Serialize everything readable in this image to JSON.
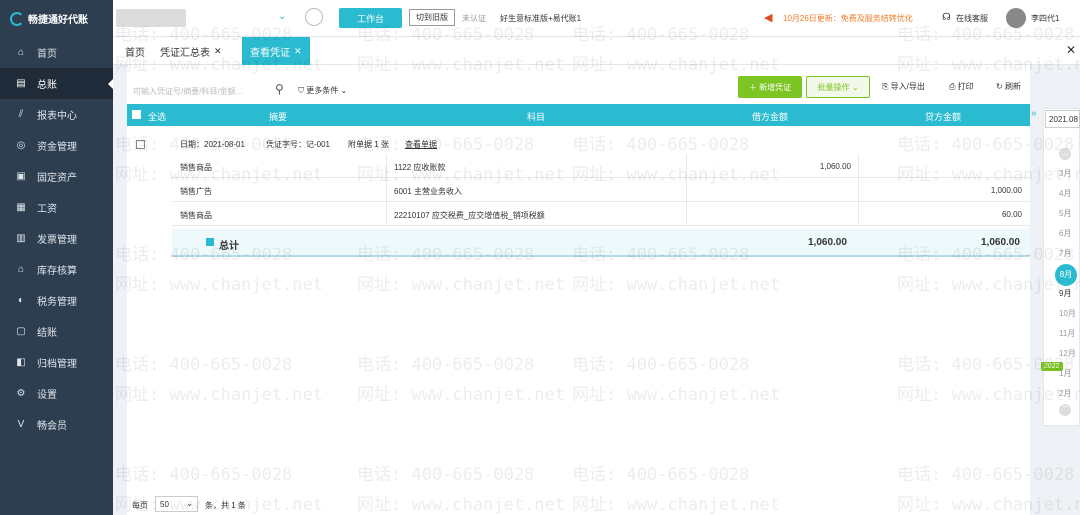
{
  "topbar": {
    "brand": "畅捷通好代账",
    "workbench_label": "工作台",
    "switch_old_label": "切到旧版",
    "verify_text": "未认证",
    "edition_text": "好生意标准版+易代账1",
    "news_text": "10月26日更新：免费及服务结转优化",
    "service_label": "在线客服",
    "username": "李四代1"
  },
  "sidebar": {
    "items": [
      {
        "label": "首页",
        "icon": "home-icon",
        "glyph": "⌂"
      },
      {
        "label": "总账",
        "icon": "ledger-icon",
        "glyph": "▤"
      },
      {
        "label": "报表中心",
        "icon": "chart-icon",
        "glyph": "⫽"
      },
      {
        "label": "资金管理",
        "icon": "money-icon",
        "glyph": "◎"
      },
      {
        "label": "固定资产",
        "icon": "asset-icon",
        "glyph": "▣"
      },
      {
        "label": "工资",
        "icon": "salary-icon",
        "glyph": "▦"
      },
      {
        "label": "发票管理",
        "icon": "invoice-icon",
        "glyph": "▥"
      },
      {
        "label": "库存核算",
        "icon": "inventory-icon",
        "glyph": "⌂"
      },
      {
        "label": "税务管理",
        "icon": "tax-icon",
        "glyph": "◐"
      },
      {
        "label": "结账",
        "icon": "close-book-icon",
        "glyph": "▢"
      },
      {
        "label": "归档管理",
        "icon": "archive-icon",
        "glyph": "◧"
      },
      {
        "label": "设置",
        "icon": "settings-icon",
        "glyph": "⚙"
      },
      {
        "label": "畅会员",
        "icon": "vip-icon",
        "glyph": "V"
      }
    ]
  },
  "tabs": [
    {
      "label": "首页"
    },
    {
      "label": "凭证汇总表"
    },
    {
      "label": "查看凭证"
    }
  ],
  "toolbar": {
    "search_placeholder": "可输入凭证号/摘要/科目/金额...",
    "more_conditions": "更多条件",
    "new_voucher": "新增凭证",
    "batch_ops": "批量操作",
    "import_export": "导入/导出",
    "print": "打印",
    "refresh": "刷新"
  },
  "table": {
    "select_all": "全选",
    "headers": [
      "摘要",
      "科目",
      "借方金额",
      "贷方金额"
    ],
    "voucher": {
      "date": "日期：2021-08-01",
      "number": "凭证字号：记-001",
      "attachments": "附单据 1 张",
      "view_doc": "查看单据"
    },
    "rows": [
      {
        "summary": "销售商品",
        "account": "1122 应收账款",
        "debit": "1,060.00",
        "credit": ""
      },
      {
        "summary": "销售广告",
        "account": "6001 主营业务收入",
        "debit": "",
        "credit": "1,000.00"
      },
      {
        "summary": "销售商品",
        "account": "22210107 应交税费_应交增值税_销项税额",
        "debit": "",
        "credit": "60.00"
      }
    ],
    "total_label": "总计",
    "total_debit": "1,060.00",
    "total_credit": "1,060.00"
  },
  "pager": {
    "per_page_label": "每页",
    "per_page_value": "50",
    "total_text": "条，共 1 条"
  },
  "period_picker": {
    "year_value": "2021.08",
    "months": [
      "3月",
      "4月",
      "5月",
      "6月",
      "7月",
      "8月",
      "9月",
      "10月",
      "11月",
      "12月",
      "1月",
      "2月"
    ],
    "selected": "8月",
    "year_tag": "2022"
  },
  "watermark": {
    "phone": "电话: 400-665-0028",
    "site": "网址: www.chanjet.net"
  }
}
